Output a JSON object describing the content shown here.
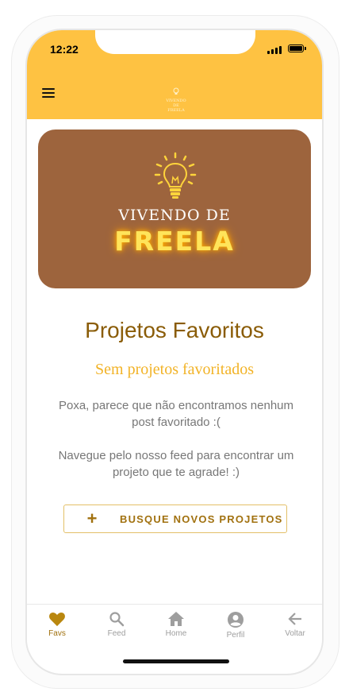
{
  "status_bar": {
    "time": "12:22"
  },
  "banner": {
    "line1": "VIVENDO DE",
    "line2": "FREELA"
  },
  "header_logo": {
    "line1": "VIVENDO DE",
    "line2": "FREELA"
  },
  "main": {
    "title": "Projetos Favoritos",
    "subtitle": "Sem projetos favoritados",
    "paragraph1": "Poxa, parece que não encontramos nenhum post favoritado :(",
    "paragraph2": "Navegue pelo nosso feed para encontrar um projeto que te agrade! :)",
    "cta_label": "BUSQUE NOVOS PROJETOS"
  },
  "tabs": [
    {
      "label": "Favs",
      "icon": "heart-icon"
    },
    {
      "label": "Feed",
      "icon": "search-icon"
    },
    {
      "label": "Home",
      "icon": "home-icon"
    },
    {
      "label": "Perfil",
      "icon": "profile-icon"
    },
    {
      "label": "Voltar",
      "icon": "back-arrow-icon"
    }
  ],
  "colors": {
    "header": "#fec242",
    "banner": "#9d643d",
    "accent": "#a1710f",
    "subtitle": "#f2b327",
    "title": "#8a5c07"
  }
}
